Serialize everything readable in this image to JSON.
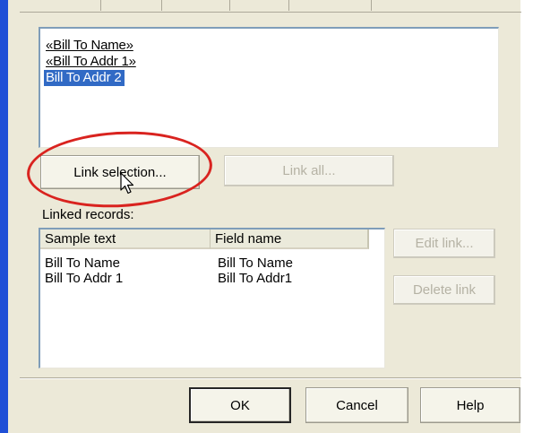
{
  "text_box": {
    "lines": [
      "«Bill To Name»",
      "«Bill To Addr 1»",
      "Bill To Addr 2"
    ]
  },
  "buttons": {
    "link_selection": "Link selection...",
    "link_all": "Link all...",
    "edit_link": "Edit link...",
    "delete_link": "Delete link",
    "ok": "OK",
    "cancel": "Cancel",
    "help": "Help"
  },
  "linked_records": {
    "label": "Linked records:",
    "columns": [
      "Sample text",
      "Field name"
    ],
    "rows": [
      {
        "sample": "Bill To Name",
        "field": "Bill To Name"
      },
      {
        "sample": "Bill To Addr 1",
        "field": "Bill To Addr1"
      }
    ]
  },
  "colors": {
    "selection": "#316ac5",
    "annotation_oval": "#d9231f",
    "window_frame": "#1f4fd6"
  },
  "icons": {
    "cursor": "arrow-pointer-icon",
    "annotation": "red-oval-highlight"
  }
}
